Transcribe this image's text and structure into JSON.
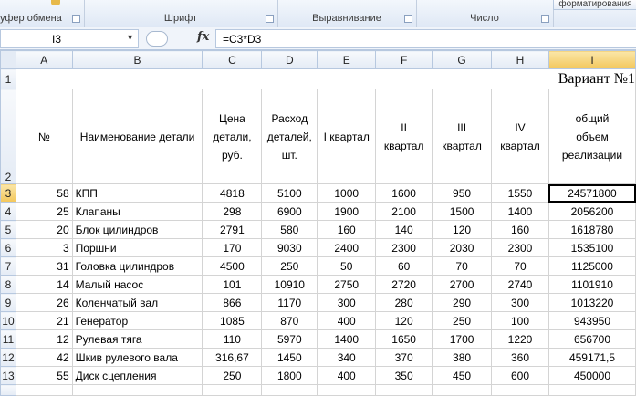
{
  "ribbon": {
    "groups": [
      "уфер обмена",
      "Шрифт",
      "Выравнивание",
      "Число"
    ],
    "format_button": "форматирования"
  },
  "formula_bar": {
    "name_box": "I3",
    "fx": "fx",
    "formula": "=C3*D3"
  },
  "columns": [
    "A",
    "B",
    "C",
    "D",
    "E",
    "F",
    "G",
    "H",
    "I"
  ],
  "selected_column": "I",
  "title": "Вариант №1",
  "headers": {
    "a": "№",
    "b": "Наименование детали",
    "c": "Цена детали, руб.",
    "d": "Расход деталей, шт.",
    "e": "I квартал",
    "f": "II квартал",
    "g": "III квартал",
    "h": "IV квартал",
    "i": "общий объем реализации"
  },
  "rows": [
    {
      "rn": "3",
      "a": "58",
      "b": "КПП",
      "c": "4818",
      "d": "5100",
      "e": "1000",
      "f": "1600",
      "g": "950",
      "h": "1550",
      "i": "24571800"
    },
    {
      "rn": "4",
      "a": "25",
      "b": "Клапаны",
      "c": "298",
      "d": "6900",
      "e": "1900",
      "f": "2100",
      "g": "1500",
      "h": "1400",
      "i": "2056200"
    },
    {
      "rn": "5",
      "a": "20",
      "b": "Блок цилиндров",
      "c": "2791",
      "d": "580",
      "e": "160",
      "f": "140",
      "g": "120",
      "h": "160",
      "i": "1618780"
    },
    {
      "rn": "6",
      "a": "3",
      "b": "Поршни",
      "c": "170",
      "d": "9030",
      "e": "2400",
      "f": "2300",
      "g": "2030",
      "h": "2300",
      "i": "1535100"
    },
    {
      "rn": "7",
      "a": "31",
      "b": "Головка цилиндров",
      "c": "4500",
      "d": "250",
      "e": "50",
      "f": "60",
      "g": "70",
      "h": "70",
      "i": "1125000"
    },
    {
      "rn": "8",
      "a": "14",
      "b": "Малый насос",
      "c": "101",
      "d": "10910",
      "e": "2750",
      "f": "2720",
      "g": "2700",
      "h": "2740",
      "i": "1101910"
    },
    {
      "rn": "9",
      "a": "26",
      "b": "Коленчатый вал",
      "c": "866",
      "d": "1170",
      "e": "300",
      "f": "280",
      "g": "290",
      "h": "300",
      "i": "1013220"
    },
    {
      "rn": "10",
      "a": "21",
      "b": "Генератор",
      "c": "1085",
      "d": "870",
      "e": "400",
      "f": "120",
      "g": "250",
      "h": "100",
      "i": "943950"
    },
    {
      "rn": "11",
      "a": "12",
      "b": "Рулевая тяга",
      "c": "110",
      "d": "5970",
      "e": "1400",
      "f": "1650",
      "g": "1700",
      "h": "1220",
      "i": "656700"
    },
    {
      "rn": "12",
      "a": "42",
      "b": "Шкив рулевого вала",
      "c": "316,67",
      "d": "1450",
      "e": "340",
      "f": "370",
      "g": "380",
      "h": "360",
      "i": "459171,5"
    },
    {
      "rn": "13",
      "a": "55",
      "b": "Диск сцепления",
      "c": "250",
      "d": "1800",
      "e": "400",
      "f": "350",
      "g": "450",
      "h": "600",
      "i": "450000"
    }
  ]
}
